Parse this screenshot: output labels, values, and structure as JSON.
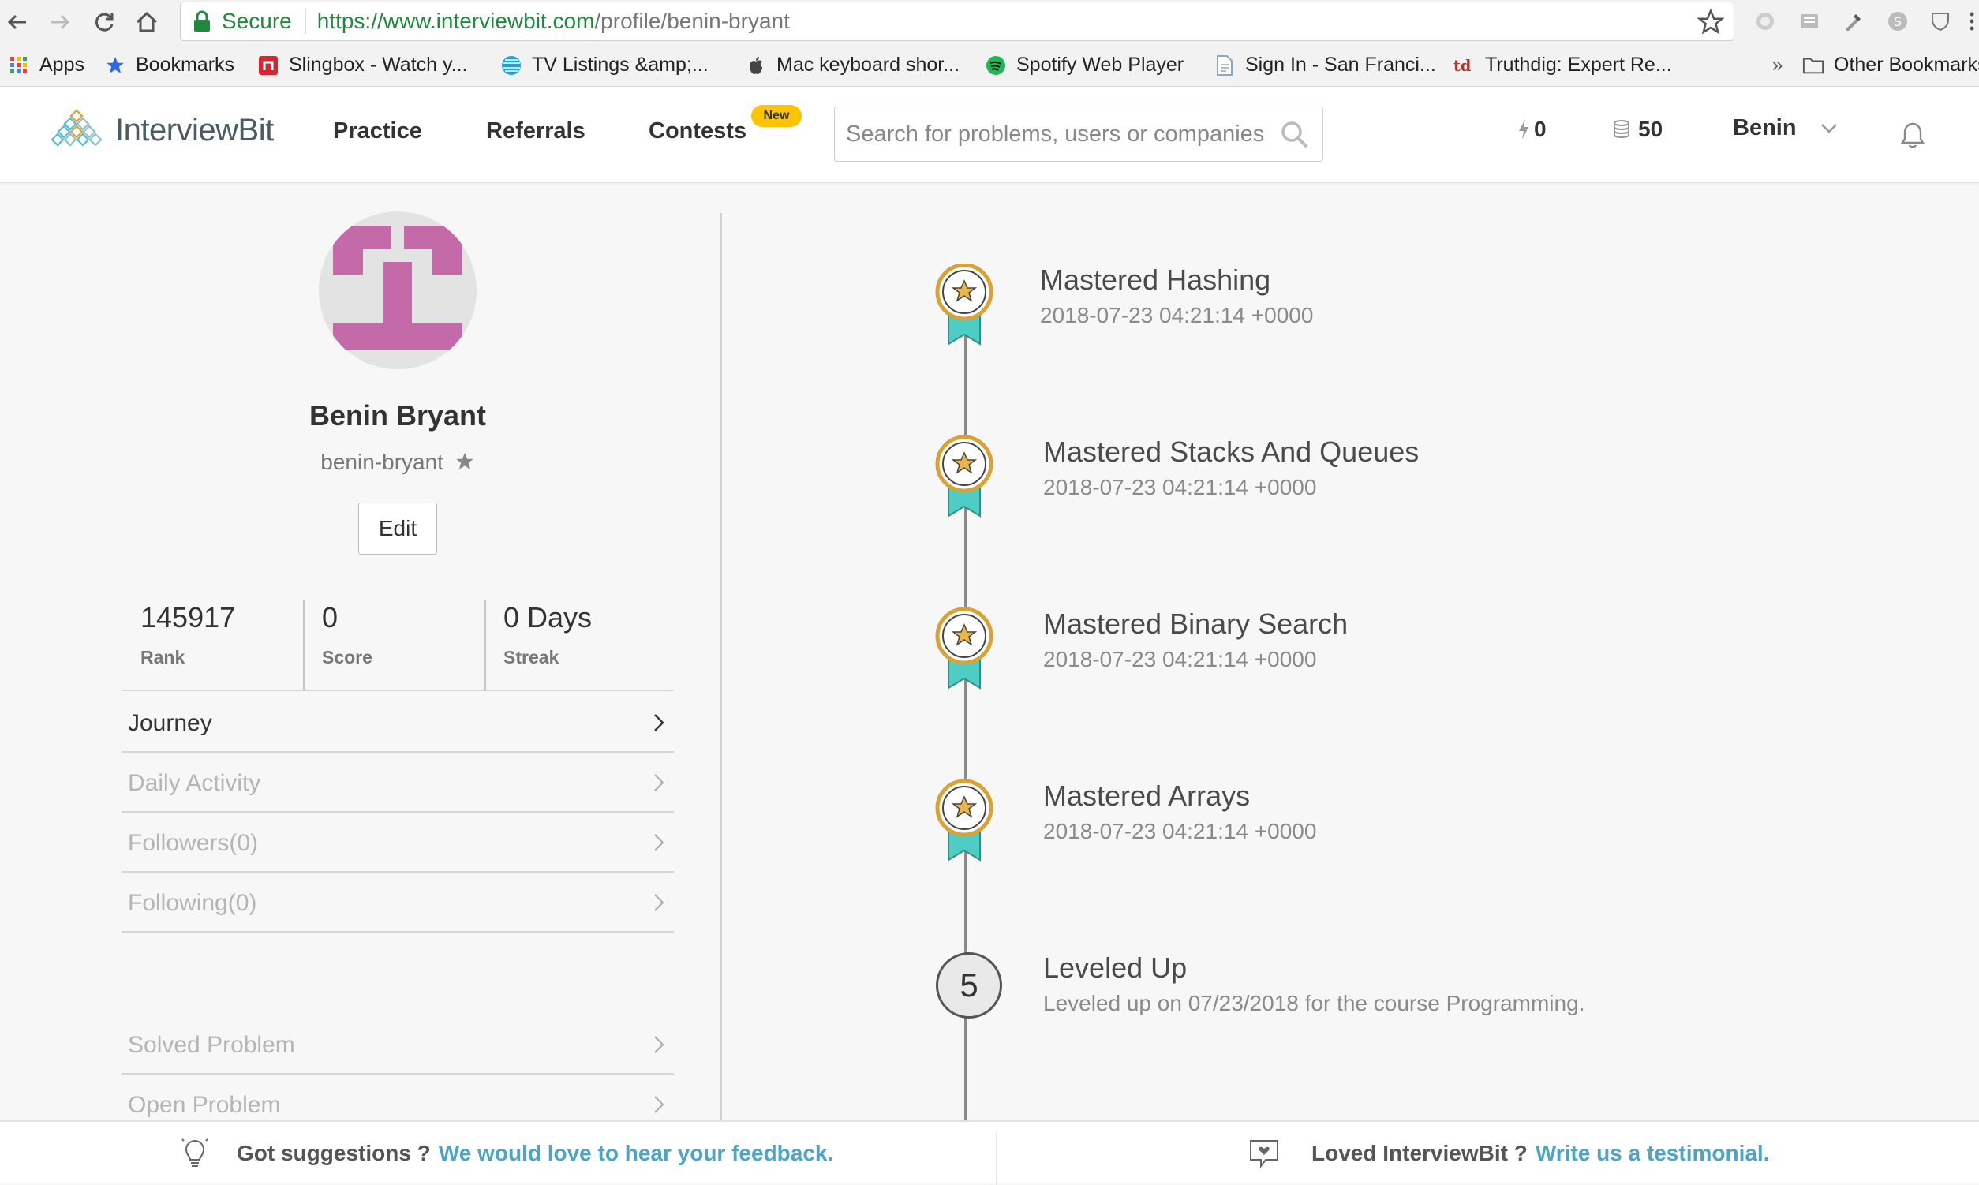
{
  "browser": {
    "secure_label": "Secure",
    "url_host": "https://www.interviewbit.com",
    "url_path": "/profile/benin-bryant",
    "bookmarks": [
      {
        "label": "Apps",
        "icon": "apps-grid-icon"
      },
      {
        "label": "Bookmarks",
        "icon": "star-icon"
      },
      {
        "label": "Slingbox - Watch y...",
        "icon": "slingbox-icon"
      },
      {
        "label": "TV Listings &amp;...",
        "icon": "att-globe-icon"
      },
      {
        "label": "Mac keyboard shor...",
        "icon": "apple-icon"
      },
      {
        "label": "Spotify Web Player",
        "icon": "spotify-icon"
      },
      {
        "label": "Sign In - San Franci...",
        "icon": "page-icon"
      },
      {
        "label": "Truthdig: Expert Re...",
        "icon": "truthdig-icon"
      }
    ],
    "overflow": "»",
    "other_bookmarks": "Other Bookmarks"
  },
  "site": {
    "logo": "InterviewBit",
    "nav": {
      "practice": "Practice",
      "referrals": "Referrals",
      "contests": "Contests",
      "new_badge": "New"
    },
    "search_placeholder": "Search for problems, users or companies",
    "streak_count": "0",
    "coins": "50",
    "user": "Benin"
  },
  "profile": {
    "name": "Benin Bryant",
    "handle": "benin-bryant",
    "edit_label": "Edit",
    "stats": [
      {
        "value": "145917",
        "label": "Rank"
      },
      {
        "value": "0",
        "label": "Score"
      },
      {
        "value": "0 Days",
        "label": "Streak"
      }
    ],
    "menu": [
      "Journey",
      "Daily Activity",
      "Followers(0)",
      "Following(0)"
    ],
    "menu2": [
      "Solved Problem",
      "Open Problem"
    ]
  },
  "timeline": [
    {
      "title": "Mastered Hashing",
      "sub": "2018-07-23 04:21:14 +0000"
    },
    {
      "title": "Mastered Stacks And Queues",
      "sub": "2018-07-23 04:21:14 +0000"
    },
    {
      "title": "Mastered Binary Search",
      "sub": "2018-07-23 04:21:14 +0000"
    },
    {
      "title": "Mastered Arrays",
      "sub": "2018-07-23 04:21:14 +0000"
    },
    {
      "level": "5",
      "title": "Leveled Up",
      "sub": "Leveled up on 07/23/2018 for the course Programming."
    }
  ],
  "footer": {
    "left_text": "Got suggestions ?",
    "left_link": "We would love to hear your feedback.",
    "right_text": "Loved InterviewBit ?",
    "right_link": "Write us a testimonial."
  },
  "colors": {
    "accent_teal": "#4fa4c4",
    "secure_green": "#1f8a3e",
    "badge_yellow": "#ffc400",
    "avatar_pink": "#c46aa8",
    "medal_teal": "#4ecdc4",
    "medal_gold": "#d8a235"
  }
}
